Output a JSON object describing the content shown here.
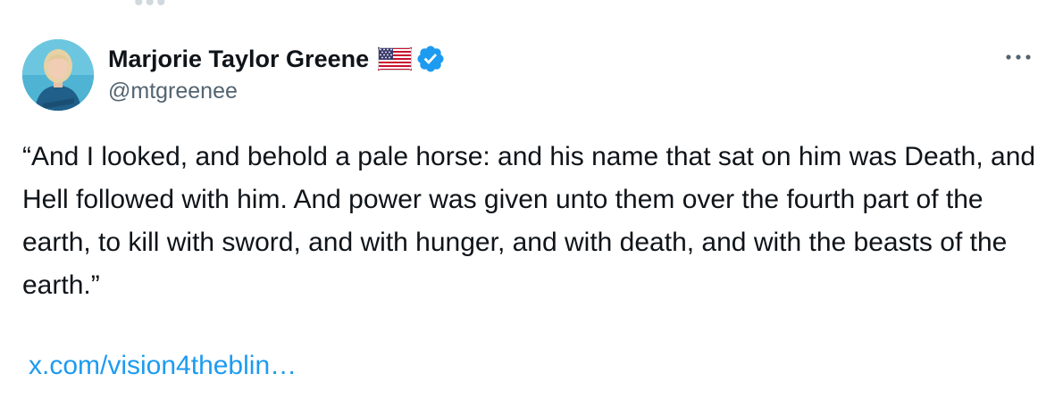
{
  "author": {
    "display_name": "Marjorie Taylor Greene",
    "handle": "@mtgreenee",
    "flag_icon": "us-flag-icon",
    "verified_icon": "verified-badge-icon",
    "verified_color": "#1d9bf0"
  },
  "tweet": {
    "text": "“And I looked, and behold a pale horse: and his name that sat on him was Death, and Hell followed with him. And power was given unto them over the fourth part of the earth, to kill with sword, and with hunger, and with death, and with the beasts of the earth.”",
    "link_text": "x.com/vision4theblin…",
    "link_color": "#1d9bf0"
  },
  "menu": {
    "icon": "more-options-icon"
  }
}
